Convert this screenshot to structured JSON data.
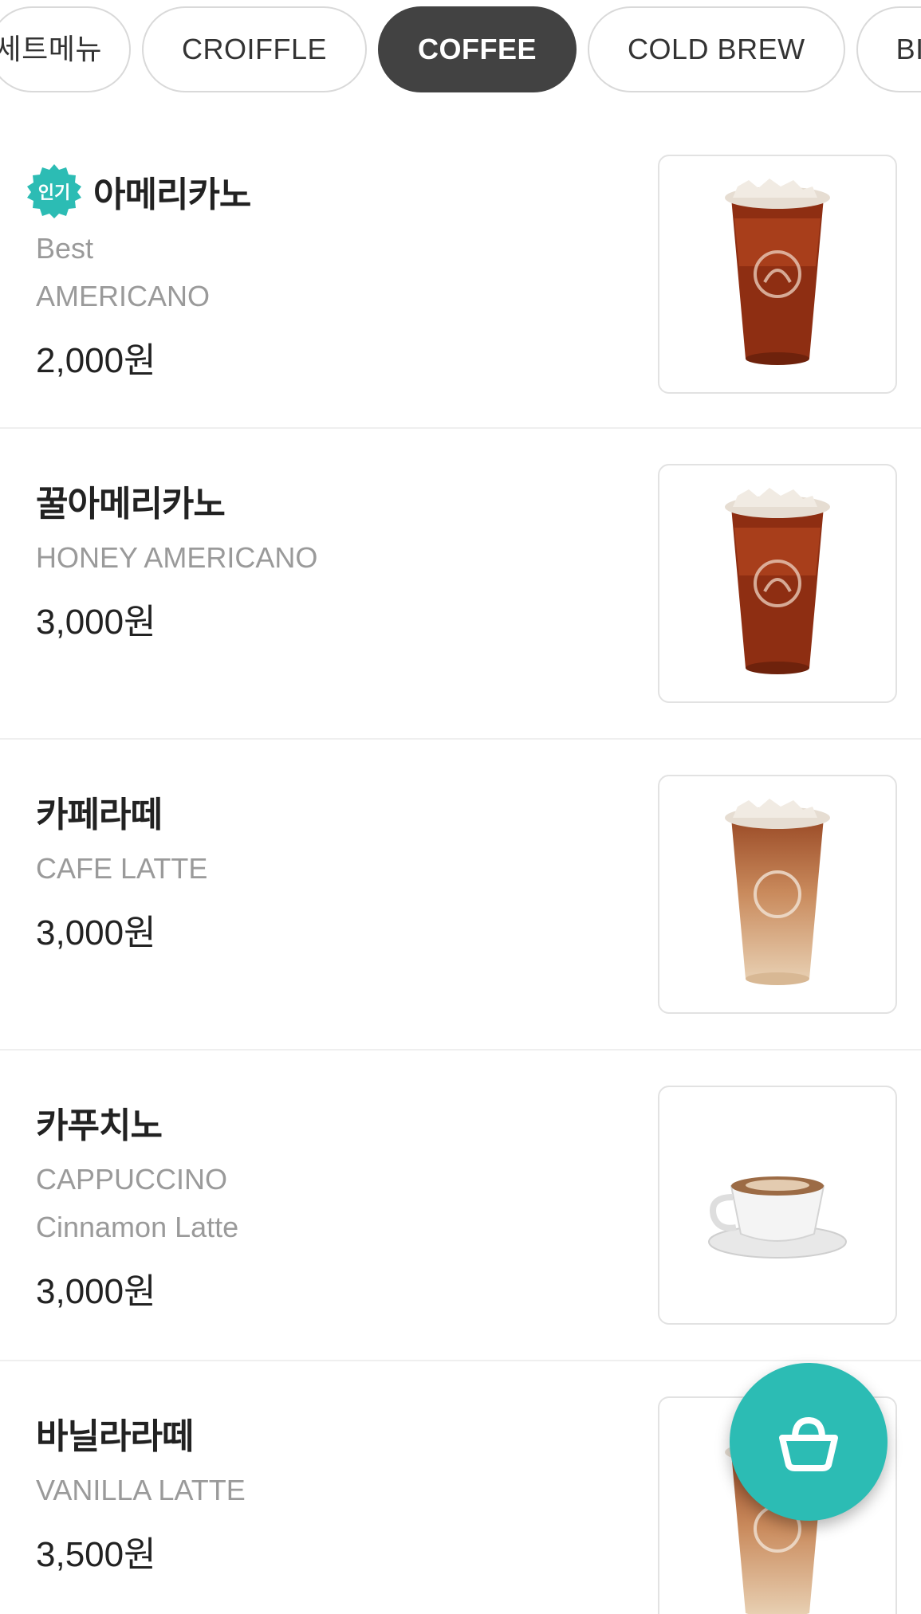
{
  "tabs": [
    {
      "label": "세트메뉴",
      "active": false
    },
    {
      "label": "CROIFFLE",
      "active": false
    },
    {
      "label": "COFFEE",
      "active": true
    },
    {
      "label": "COLD BREW",
      "active": false
    },
    {
      "label": "BIG",
      "active": false
    }
  ],
  "popular_badge": "인기",
  "items": [
    {
      "name": "아메리카노",
      "sub1": "Best",
      "sub2": "AMERICANO",
      "price": "2,000원",
      "image": "iced-americano"
    },
    {
      "name": "꿀아메리카노",
      "sub1": "HONEY AMERICANO",
      "price": "3,000원",
      "image": "iced-americano"
    },
    {
      "name": "카페라떼",
      "sub1": "CAFE LATTE",
      "price": "3,000원",
      "image": "iced-latte"
    },
    {
      "name": "카푸치노",
      "sub1": "CAPPUCCINO",
      "sub2": "Cinnamon Latte",
      "price": "3,000원",
      "image": "hot-cappuccino-cup"
    },
    {
      "name": "바닐라라떼",
      "sub1": "VANILLA LATTE",
      "price": "3,500원",
      "image": "iced-latte"
    }
  ],
  "cart": {
    "icon": "shopping-basket-icon"
  },
  "colors": {
    "accent": "#2cbcb4",
    "tab_active": "#424242",
    "subtext": "#9a9a9a"
  }
}
